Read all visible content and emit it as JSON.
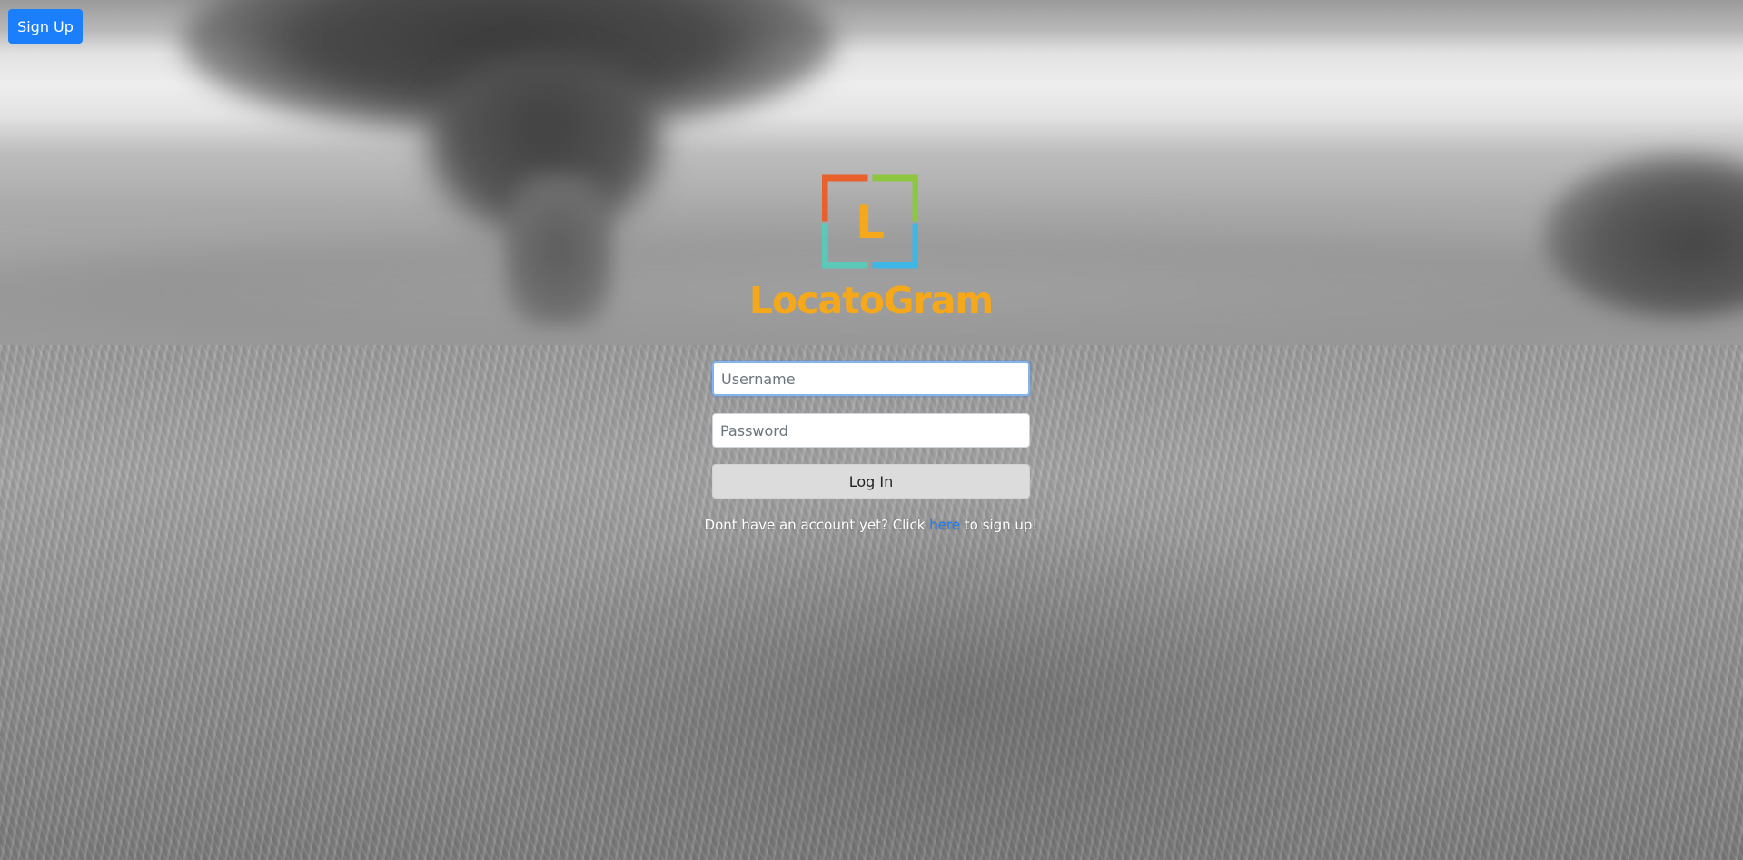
{
  "header": {
    "signup_button_label": "Sign Up"
  },
  "brand": {
    "logo_letter": "L",
    "name": "LocatoGram",
    "name_color": "#f6a81b",
    "logo_colors": {
      "top_left": "#e8612c",
      "top_right": "#8dc63f",
      "bottom_left": "#5cc9b8",
      "bottom_right": "#3fb7e6",
      "letter": "#f6a81b"
    }
  },
  "login_form": {
    "username_placeholder": "Username",
    "password_placeholder": "Password",
    "login_button_label": "Log In",
    "signup_prompt_before": "Dont have an account yet? Click ",
    "signup_link_text": "here",
    "signup_prompt_after": " to sign up!"
  },
  "colors": {
    "primary_button": "#1b7ffc",
    "login_button": "#dcdcdc",
    "link": "#1b7ffc"
  }
}
